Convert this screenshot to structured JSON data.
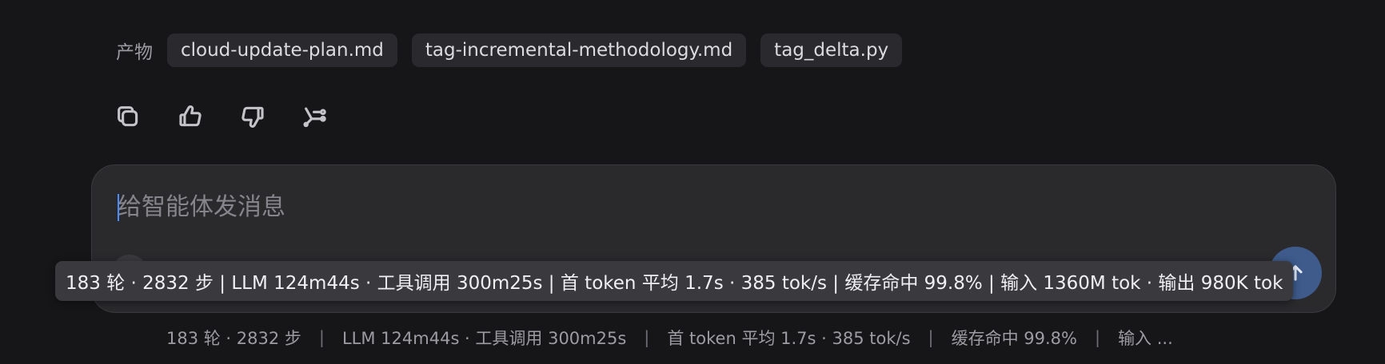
{
  "artifacts": {
    "label": "产物",
    "files": [
      "cloud-update-plan.md",
      "tag-incremental-methodology.md",
      "tag_delta.py"
    ]
  },
  "actions": {
    "icons": [
      "copy-icon",
      "thumbs-up-icon",
      "thumbs-down-icon",
      "branch-icon"
    ]
  },
  "composer": {
    "placeholder": "给智能体发消息",
    "value": ""
  },
  "tooltip": {
    "text": "183 轮 · 2832 步 | LLM 124m44s · 工具调用 300m25s | 首 token 平均 1.7s · 385 tok/s | 缓存命中 99.8% | 输入 1360M tok · 输出 980K tok"
  },
  "stats": {
    "turns_steps": "183 轮 · 2832 步",
    "llm_tools": "LLM 124m44s · 工具调用 300m25s",
    "first_token": "首 token 平均 1.7s · 385 tok/s",
    "cache": "缓存命中 99.8%",
    "io_truncated": "输入 ...",
    "separator": "|"
  },
  "colors": {
    "background": "#161618",
    "chip": "#2a2a2e",
    "composer": "#2a2a2d",
    "accent": "#4a8cff",
    "send_button": "#3e5b8c"
  }
}
